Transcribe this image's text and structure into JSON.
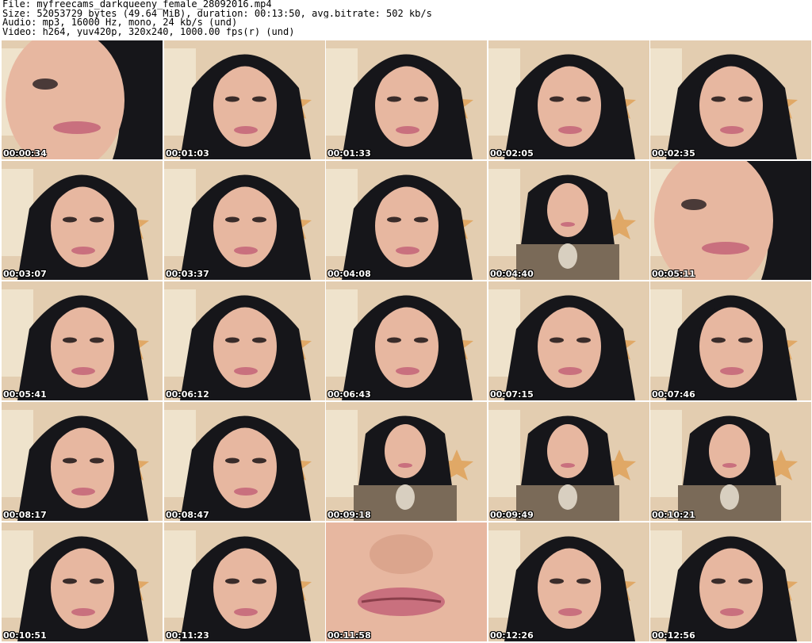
{
  "header": {
    "file": "File: myfreecams_darkqueeny_female_28092016.mp4",
    "size": "Size: 52053729 bytes (49.64 MiB), duration: 00:13:50, avg.bitrate: 502 kb/s",
    "audio": "Audio: mp3, 16000 Hz, mono, 24 kb/s (und)",
    "video": "Video: h264, yuv420p, 320x240, 1000.00 fps(r) (und)"
  },
  "thumbnails": [
    {
      "timestamp": "00:00:34",
      "view": "closeup"
    },
    {
      "timestamp": "00:01:03",
      "view": "face"
    },
    {
      "timestamp": "00:01:33",
      "view": "face"
    },
    {
      "timestamp": "00:02:05",
      "view": "face"
    },
    {
      "timestamp": "00:02:35",
      "view": "face"
    },
    {
      "timestamp": "00:03:07",
      "view": "face"
    },
    {
      "timestamp": "00:03:37",
      "view": "face"
    },
    {
      "timestamp": "00:04:08",
      "view": "face"
    },
    {
      "timestamp": "00:04:40",
      "view": "wide"
    },
    {
      "timestamp": "00:05:11",
      "view": "closeup"
    },
    {
      "timestamp": "00:05:41",
      "view": "face"
    },
    {
      "timestamp": "00:06:12",
      "view": "face"
    },
    {
      "timestamp": "00:06:43",
      "view": "face"
    },
    {
      "timestamp": "00:07:15",
      "view": "face"
    },
    {
      "timestamp": "00:07:46",
      "view": "face"
    },
    {
      "timestamp": "00:08:17",
      "view": "face"
    },
    {
      "timestamp": "00:08:47",
      "view": "face"
    },
    {
      "timestamp": "00:09:18",
      "view": "wide"
    },
    {
      "timestamp": "00:09:49",
      "view": "wide"
    },
    {
      "timestamp": "00:10:21",
      "view": "wide"
    },
    {
      "timestamp": "00:10:51",
      "view": "face"
    },
    {
      "timestamp": "00:11:23",
      "view": "face"
    },
    {
      "timestamp": "00:11:58",
      "view": "lips"
    },
    {
      "timestamp": "00:12:26",
      "view": "face"
    },
    {
      "timestamp": "00:12:56",
      "view": "face"
    }
  ],
  "colors": {
    "background": "#ffffff",
    "wall": "#e3cdb0",
    "hair": "#16161a",
    "skin": "#e7b7a0",
    "lips": "#c9707e",
    "top": "#7a6a58",
    "timestamp_text": "#ffffff"
  }
}
